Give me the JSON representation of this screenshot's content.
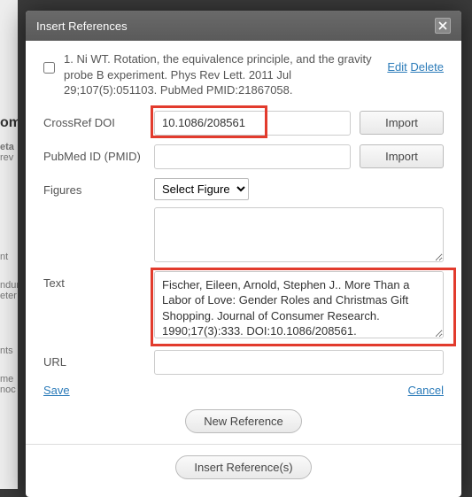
{
  "dialog": {
    "title": "Insert References"
  },
  "reference": {
    "text": "1. Ni WT. Rotation, the equivalence principle, and the gravity probe B experiment. Phys Rev Lett. 2011 Jul 29;107(5):051103. PubMed PMID:21867058.",
    "edit": "Edit",
    "delete": "Delete"
  },
  "labels": {
    "crossref": "CrossRef DOI",
    "pmid": "PubMed ID (PMID)",
    "figures": "Figures",
    "text": "Text",
    "url": "URL"
  },
  "fields": {
    "crossref_value": "10.1086/208561",
    "pmid_value": "",
    "figures_selected": "Select Figure",
    "text_value": "Fischer, Eileen, Arnold, Stephen J.. More Than a Labor of Love: Gender Roles and Christmas Gift Shopping. Journal of Consumer Research. 1990;17(3):333. DOI:10.1086/208561.",
    "url_value": ""
  },
  "buttons": {
    "import": "Import",
    "save": "Save",
    "cancel": "Cancel",
    "new_reference": "New Reference",
    "insert_references": "Insert Reference(s)"
  },
  "bg": {
    "t1": "om",
    "t2": "eta",
    "t3": "rev",
    "t4": "nt",
    "t5": "ndur",
    "t6": "eter",
    "t7": "nts",
    "t8": "me",
    "t9": "noc"
  }
}
